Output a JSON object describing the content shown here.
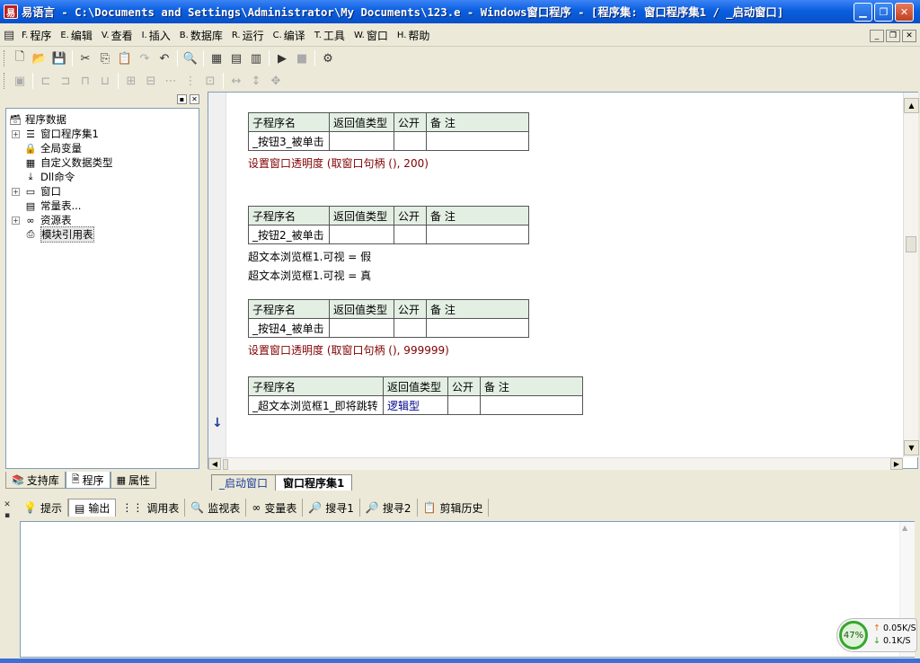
{
  "window": {
    "app_name": "易语言",
    "title": "易语言 - C:\\Documents and Settings\\Administrator\\My Documents\\123.e - Windows窗口程序 - [程序集: 窗口程序集1 / _启动窗口]"
  },
  "menu": [
    {
      "key": "F.",
      "label": "程序"
    },
    {
      "key": "E.",
      "label": "编辑"
    },
    {
      "key": "V.",
      "label": "查看"
    },
    {
      "key": "I.",
      "label": "插入"
    },
    {
      "key": "B.",
      "label": "数据库"
    },
    {
      "key": "R.",
      "label": "运行"
    },
    {
      "key": "C.",
      "label": "编译"
    },
    {
      "key": "T.",
      "label": "工具"
    },
    {
      "key": "W.",
      "label": "窗口"
    },
    {
      "key": "H.",
      "label": "帮助"
    }
  ],
  "tree": {
    "root": "程序数据",
    "items": [
      {
        "label": "窗口程序集1",
        "expandable": true
      },
      {
        "label": "全局变量",
        "expandable": false
      },
      {
        "label": "自定义数据类型",
        "expandable": false
      },
      {
        "label": "Dll命令",
        "expandable": false
      },
      {
        "label": "窗口",
        "expandable": true
      },
      {
        "label": "常量表...",
        "expandable": false
      },
      {
        "label": "资源表",
        "expandable": true
      },
      {
        "label": "模块引用表",
        "expandable": false
      }
    ]
  },
  "left_tabs": [
    "支持库",
    "程序",
    "属性"
  ],
  "headers": {
    "name": "子程序名",
    "ret": "返回值类型",
    "pub": "公开",
    "note": "备 注"
  },
  "subs": [
    {
      "name": "_按钮3_被单击",
      "ret": "",
      "code": [
        {
          "text": "设置窗口透明度 (取窗口句柄 (), 200)"
        }
      ]
    },
    {
      "name": "_按钮2_被单击",
      "ret": "",
      "code": [
        {
          "text": "超文本浏览框1.可视 = 假"
        },
        {
          "text": "超文本浏览框1.可视 = 真"
        }
      ]
    },
    {
      "name": "_按钮4_被单击",
      "ret": "",
      "code": [
        {
          "text": "设置窗口透明度 (取窗口句柄 (), 999999)"
        }
      ]
    },
    {
      "name": "_超文本浏览框1_即将跳转",
      "ret": "逻辑型",
      "code": []
    }
  ],
  "editor_tabs": [
    "_启动窗口",
    "窗口程序集1"
  ],
  "bottom_tabs": [
    "提示",
    "输出",
    "调用表",
    "监视表",
    "变量表",
    "搜寻1",
    "搜寻2",
    "剪辑历史"
  ],
  "net": {
    "percent": "47%",
    "up": "0.05K/S",
    "down": "0.1K/S"
  },
  "colors": {
    "title": "#0a5fe0",
    "code_func": "#800000",
    "header_bg": "#e4efe4"
  }
}
